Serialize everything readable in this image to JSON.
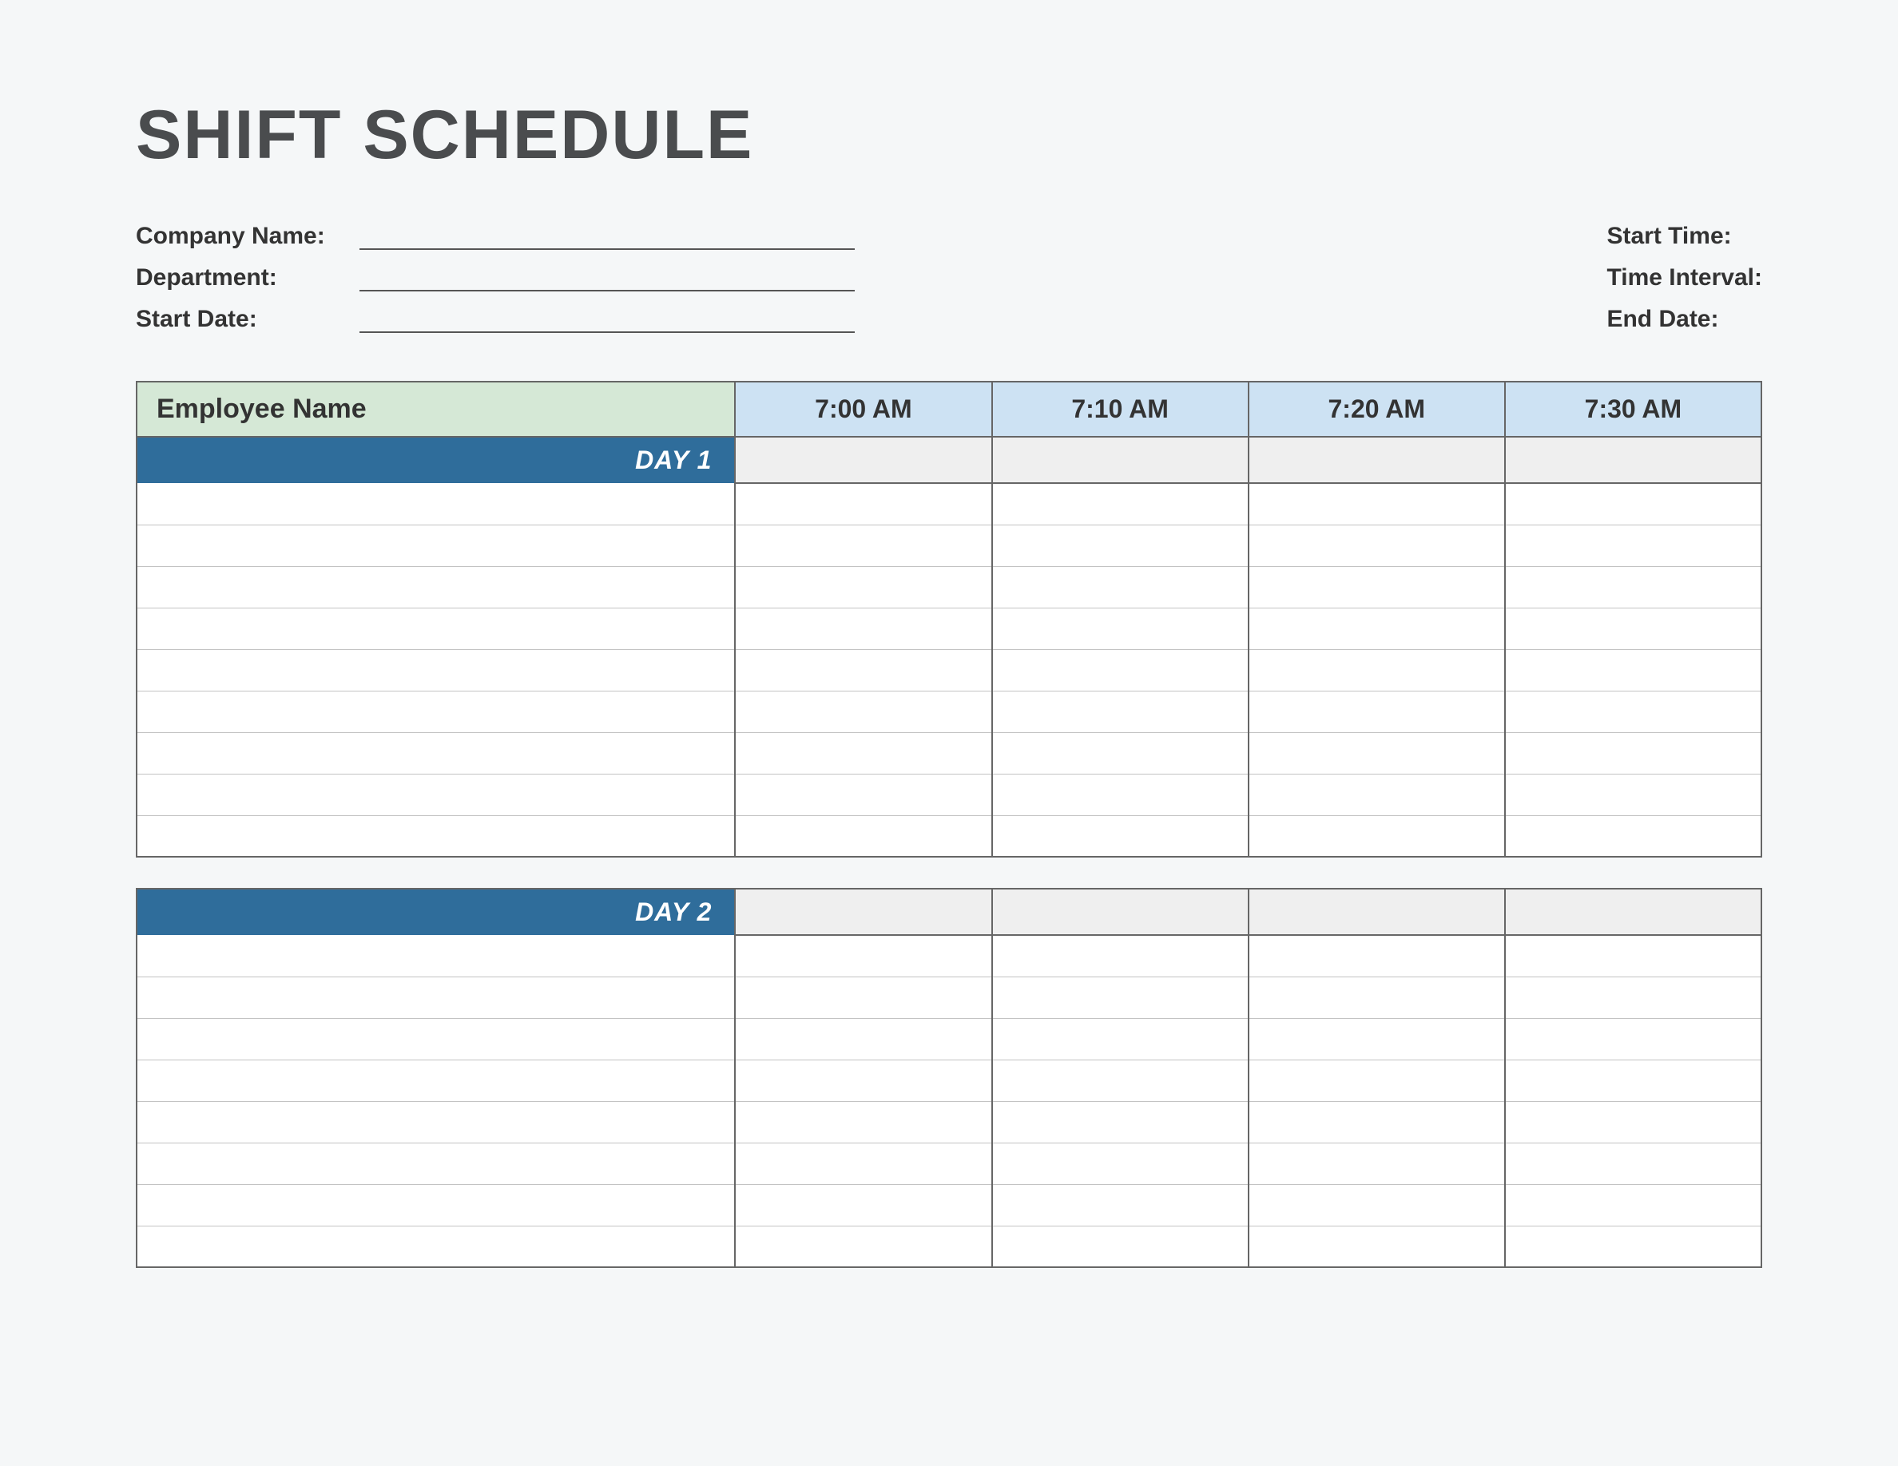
{
  "title": "SHIFT SCHEDULE",
  "meta": {
    "left": {
      "company_name_label": "Company Name:",
      "department_label": "Department:",
      "start_date_label": "Start Date:"
    },
    "right": {
      "start_time_label": "Start Time:",
      "time_interval_label": "Time Interval:",
      "end_date_label": "End Date:"
    }
  },
  "table": {
    "employee_name_header": "Employee Name",
    "time_headers": [
      "7:00 AM",
      "7:10 AM",
      "7:20 AM",
      "7:30 AM"
    ],
    "days": [
      {
        "label": "DAY 1",
        "rows": 9
      },
      {
        "label": "DAY 2",
        "rows": 8
      }
    ]
  }
}
